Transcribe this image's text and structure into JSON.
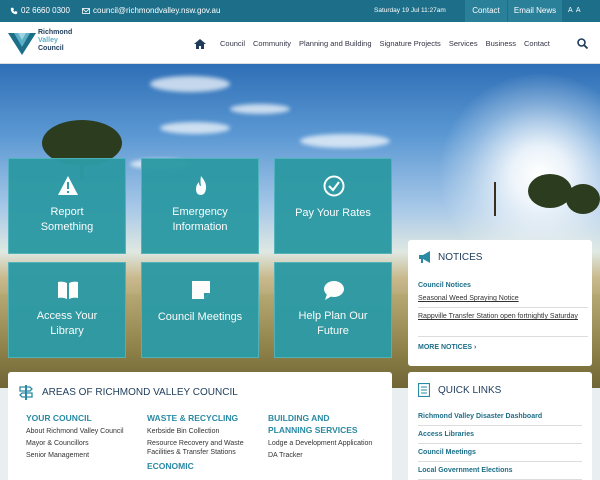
{
  "topbar": {
    "phone": "02 6660 0300",
    "email": "council@richmondvalley.nsw.gov.au",
    "datetime": "Saturday 19 Jul 11:27am",
    "contact_label": "Contact",
    "email_news_label": "Email News",
    "font_size_label": "A A"
  },
  "header": {
    "logo_line1": "Richmond",
    "logo_line2": "Valley",
    "logo_line3": "Council",
    "nav": [
      "Council",
      "Community",
      "Planning and Building",
      "Signature Projects",
      "Services",
      "Business",
      "Contact"
    ]
  },
  "tiles": [
    {
      "label_1": "Report",
      "label_2": "Something",
      "icon": "warning-icon"
    },
    {
      "label_1": "Emergency",
      "label_2": "Information",
      "icon": "flame-icon"
    },
    {
      "label_1": "Pay Your Rates",
      "label_2": "",
      "icon": "check-circle-icon"
    },
    {
      "label_1": "Access Your",
      "label_2": "Library",
      "icon": "book-icon"
    },
    {
      "label_1": "Council Meetings",
      "label_2": "",
      "icon": "note-icon"
    },
    {
      "label_1": "Help Plan Our",
      "label_2": "Future",
      "icon": "chat-icon"
    }
  ],
  "notices": {
    "title": "NOTICES",
    "subheading": "Council Notices",
    "items": [
      "Seasonal Weed Spraying Notice",
      "Rappville Transfer Station open fortnightly Saturday"
    ],
    "more_label": "MORE NOTICES"
  },
  "areas": {
    "title": "AREAS OF RICHMOND VALLEY COUNCIL",
    "your_council": {
      "heading": "YOUR COUNCIL",
      "links": [
        "About Richmond Valley Council",
        "Mayor & Councillors",
        "Senior Management"
      ]
    },
    "waste": {
      "heading": "WASTE & RECYCLING",
      "links": [
        "Kerbside Bin Collection",
        "Resource Recovery and Waste Facilities & Transfer Stations"
      ]
    },
    "economic": {
      "heading": "ECONOMIC"
    },
    "building": {
      "heading_1": "BUILDING AND",
      "heading_2": "PLANNING SERVICES",
      "links": [
        "Lodge a Development Application",
        "DA Tracker"
      ]
    }
  },
  "quick_links": {
    "title": "QUICK LINKS",
    "items": [
      "Richmond Valley Disaster Dashboard",
      "Access Libraries",
      "Council Meetings",
      "Local Government Elections"
    ]
  },
  "colors": {
    "topbar": "#1d6e88",
    "tile": "#2d9aa4",
    "accent": "#2a8aa3",
    "heading": "#1e3c5a"
  }
}
